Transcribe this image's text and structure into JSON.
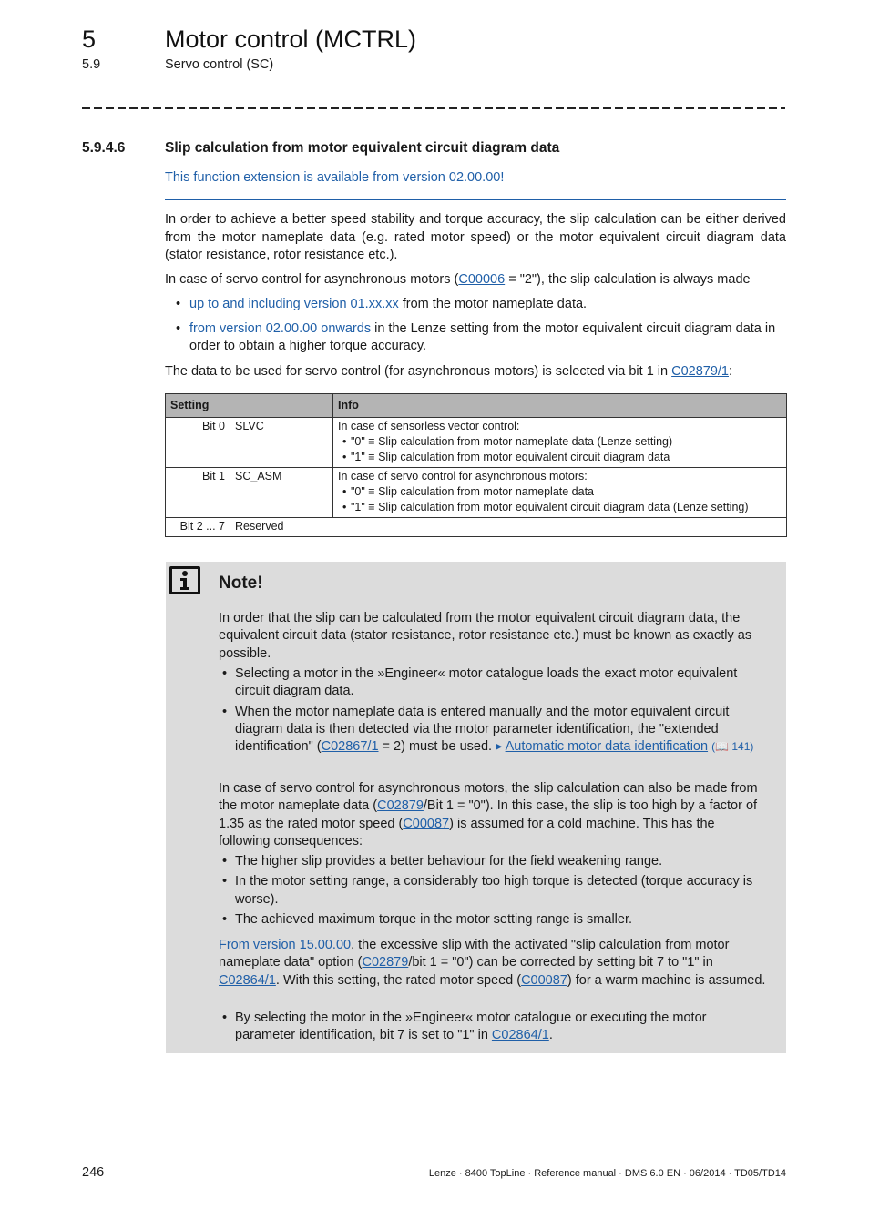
{
  "header": {
    "chapter_number": "5",
    "chapter_title": "Motor control (MCTRL)",
    "section_number": "5.9",
    "section_title": "Servo control (SC)"
  },
  "heading": {
    "number": "5.9.4.6",
    "title": "Slip calculation from motor equivalent circuit diagram data",
    "availability": "This function extension is available from version 02.00.00!"
  },
  "intro": {
    "para1": "In order to achieve a better speed stability and torque accuracy, the slip calculation can be either derived from the motor nameplate data (e.g. rated motor speed) or the motor equivalent circuit diagram data (stator resistance, rotor resistance etc.).",
    "para2_pre": "In case of servo control for asynchronous motors (",
    "para2_link": "C00006",
    "para2_post": " = \"2\"), the slip calculation is always made",
    "bullets": [
      {
        "link": "up to and including version 01.xx.xx",
        "text": " from the motor nameplate data."
      },
      {
        "link": "from version 02.00.00 onwards",
        "text": " in the Lenze setting from the motor equivalent circuit diagram data in order to obtain a higher torque accuracy."
      }
    ],
    "para3_pre": "The data to be used for servo control (for asynchronous motors) is selected via bit 1 in ",
    "para3_link": "C02879/1",
    "para3_post": ":"
  },
  "table": {
    "headers": [
      "Setting",
      "Info"
    ],
    "rows": [
      {
        "bit": "Bit 0",
        "name": "SLVC",
        "info_title": "In case of sensorless vector control:",
        "items": [
          "\"0\" ≡ Slip calculation from motor nameplate data (Lenze setting)",
          "\"1\" ≡ Slip calculation from motor equivalent circuit diagram data"
        ]
      },
      {
        "bit": "Bit 1",
        "name": "SC_ASM",
        "info_title": "In case of servo control for asynchronous motors:",
        "items": [
          "\"0\" ≡ Slip calculation from motor nameplate data",
          "\"1\" ≡ Slip calculation from motor equivalent circuit diagram data (Lenze setting)"
        ]
      },
      {
        "bit": "Bit 2 ... 7",
        "name": "Reserved"
      }
    ]
  },
  "note": {
    "icon": "info-icon",
    "title": "Note!",
    "para1": "In order that the slip can be calculated from the motor equivalent circuit diagram data, the equivalent circuit data (stator resistance, rotor resistance etc.) must be known as exactly as possible.",
    "bullet1": "Selecting a motor in the »Engineer« motor catalogue loads the exact motor equivalent circuit diagram data.",
    "bullet2_pre": "When the motor nameplate data is entered manually and the motor equivalent circuit diagram data is then detected via the motor parameter identification, the \"extended identification\" (",
    "bullet2_link": "C02867/1",
    "bullet2_mid": " = 2) must be used. ",
    "bullet2_xref": "Automatic motor data identification",
    "bullet2_page": "(📖 141)",
    "para2_a": "In case of servo control for asynchronous motors, the slip calculation can also be made from the motor nameplate data (",
    "para2_link1": "C02879",
    "para2_b": "/Bit 1 = \"0\"). In this case, the slip is too high by a factor of 1.35 as the rated motor speed (",
    "para2_link2": "C00087",
    "para2_c": ") is assumed for a cold machine. This has the following consequences:",
    "consequences": [
      "The higher slip provides a better behaviour for the field weakening range.",
      "In the motor setting range, a considerably too high torque is detected (torque accuracy is worse).",
      "The achieved maximum torque in the motor setting range is smaller."
    ],
    "para3_link0": "From version 15.00.00",
    "para3_a": ", the excessive slip with the activated \"slip calculation from motor nameplate data\" option (",
    "para3_link1": "C02879",
    "para3_b": "/bit 1 = \"0\") can be corrected by setting bit 7 to \"1\" in ",
    "para3_link2": "C02864/1",
    "para3_c": ". With this setting, the rated motor speed (",
    "para3_link3": "C00087",
    "para3_d": ") for a warm machine is assumed.",
    "bullet3_pre": "By selecting the motor in the »Engineer« motor catalogue or executing the motor parameter identification, bit 7 is set to \"1\" in ",
    "bullet3_link": "C02864/1",
    "bullet3_post": "."
  },
  "footer": {
    "page_number": "246",
    "info": "Lenze · 8400 TopLine · Reference manual · DMS 6.0 EN · 06/2014 · TD05/TD14"
  }
}
